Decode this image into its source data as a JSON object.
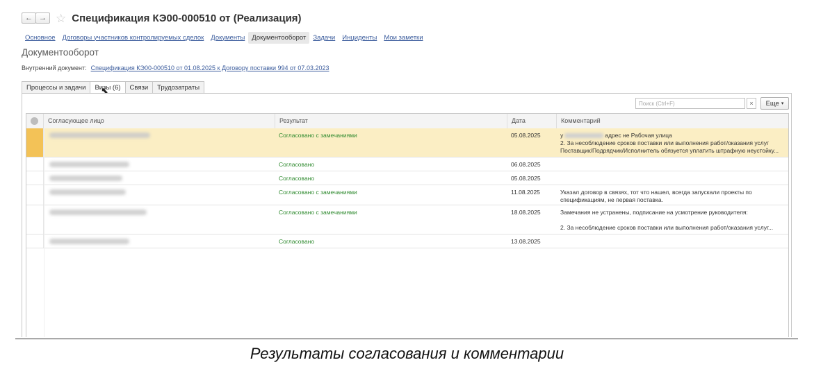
{
  "window": {
    "title": "Спецификация КЭ00-000510 от (Реализация)",
    "back_label": "←",
    "forward_label": "→",
    "favorite_icon": "☆"
  },
  "sections": [
    {
      "label": "Основное",
      "active": false
    },
    {
      "label": "Договоры участников контролируемых сделок",
      "active": false
    },
    {
      "label": "Документы",
      "active": false
    },
    {
      "label": "Документооборот",
      "active": true
    },
    {
      "label": "Задачи",
      "active": false
    },
    {
      "label": "Инциденты",
      "active": false
    },
    {
      "label": "Мои заметки",
      "active": false
    }
  ],
  "form": {
    "title": "Документооборот",
    "internal_doc_label": "Внутренний документ:",
    "internal_doc_link": "Спецификация КЭ00-000510 от 01.08.2025 к Договору поставки 994 от 07.03.2023"
  },
  "tabs": [
    {
      "label": "Процессы и задачи",
      "active": false
    },
    {
      "label": "Визы (6)",
      "active": true
    },
    {
      "label": "Связи",
      "active": false
    },
    {
      "label": "Трудозатраты",
      "active": false
    }
  ],
  "toolbar": {
    "search_placeholder": "Поиск (Ctrl+F)",
    "clear_label": "×",
    "more_label": "Еще",
    "more_arrow": "▾"
  },
  "table": {
    "columns": [
      "Согласующее лицо",
      "Результат",
      "Дата",
      "Комментарий"
    ],
    "rows": [
      {
        "result": "Согласовано с замечаниями",
        "date": "05.08.2025",
        "comment_prefix": "у",
        "comment_first": "адрес не Рабочая улица",
        "comment_rest": "2. За несоблюдение сроков поставки или выполнения работ/оказания услуг\nПоставщик/Подрядчик/Исполнитель обязуется уплатить штрафную неустойку...",
        "selected": true
      },
      {
        "result": "Согласовано",
        "date": "06.08.2025",
        "comment_prefix": "",
        "comment_first": "",
        "comment_rest": "",
        "selected": false
      },
      {
        "result": "Согласовано",
        "date": "05.08.2025",
        "comment_prefix": "",
        "comment_first": "",
        "comment_rest": "",
        "selected": false
      },
      {
        "result": "Согласовано с замечаниями",
        "date": "11.08.2025",
        "comment_prefix": "",
        "comment_first": "Указал договор в связях, тот что нашел, всегда запускали проекты по",
        "comment_rest": "спецификациям, не первая поставка.",
        "selected": false
      },
      {
        "result": "Согласовано с замечаниями",
        "date": "18.08.2025",
        "comment_prefix": "",
        "comment_first": "Замечания не устранены, подписание на усмотрение руководителя:",
        "comment_rest": "\n2. За несоблюдение сроков поставки или выполнения работ/оказания услуг...",
        "selected": false
      },
      {
        "result": "Согласовано",
        "date": "13.08.2025",
        "comment_prefix": "",
        "comment_first": "",
        "comment_rest": "",
        "selected": false
      }
    ]
  },
  "caption": "Результаты согласования и комментарии"
}
